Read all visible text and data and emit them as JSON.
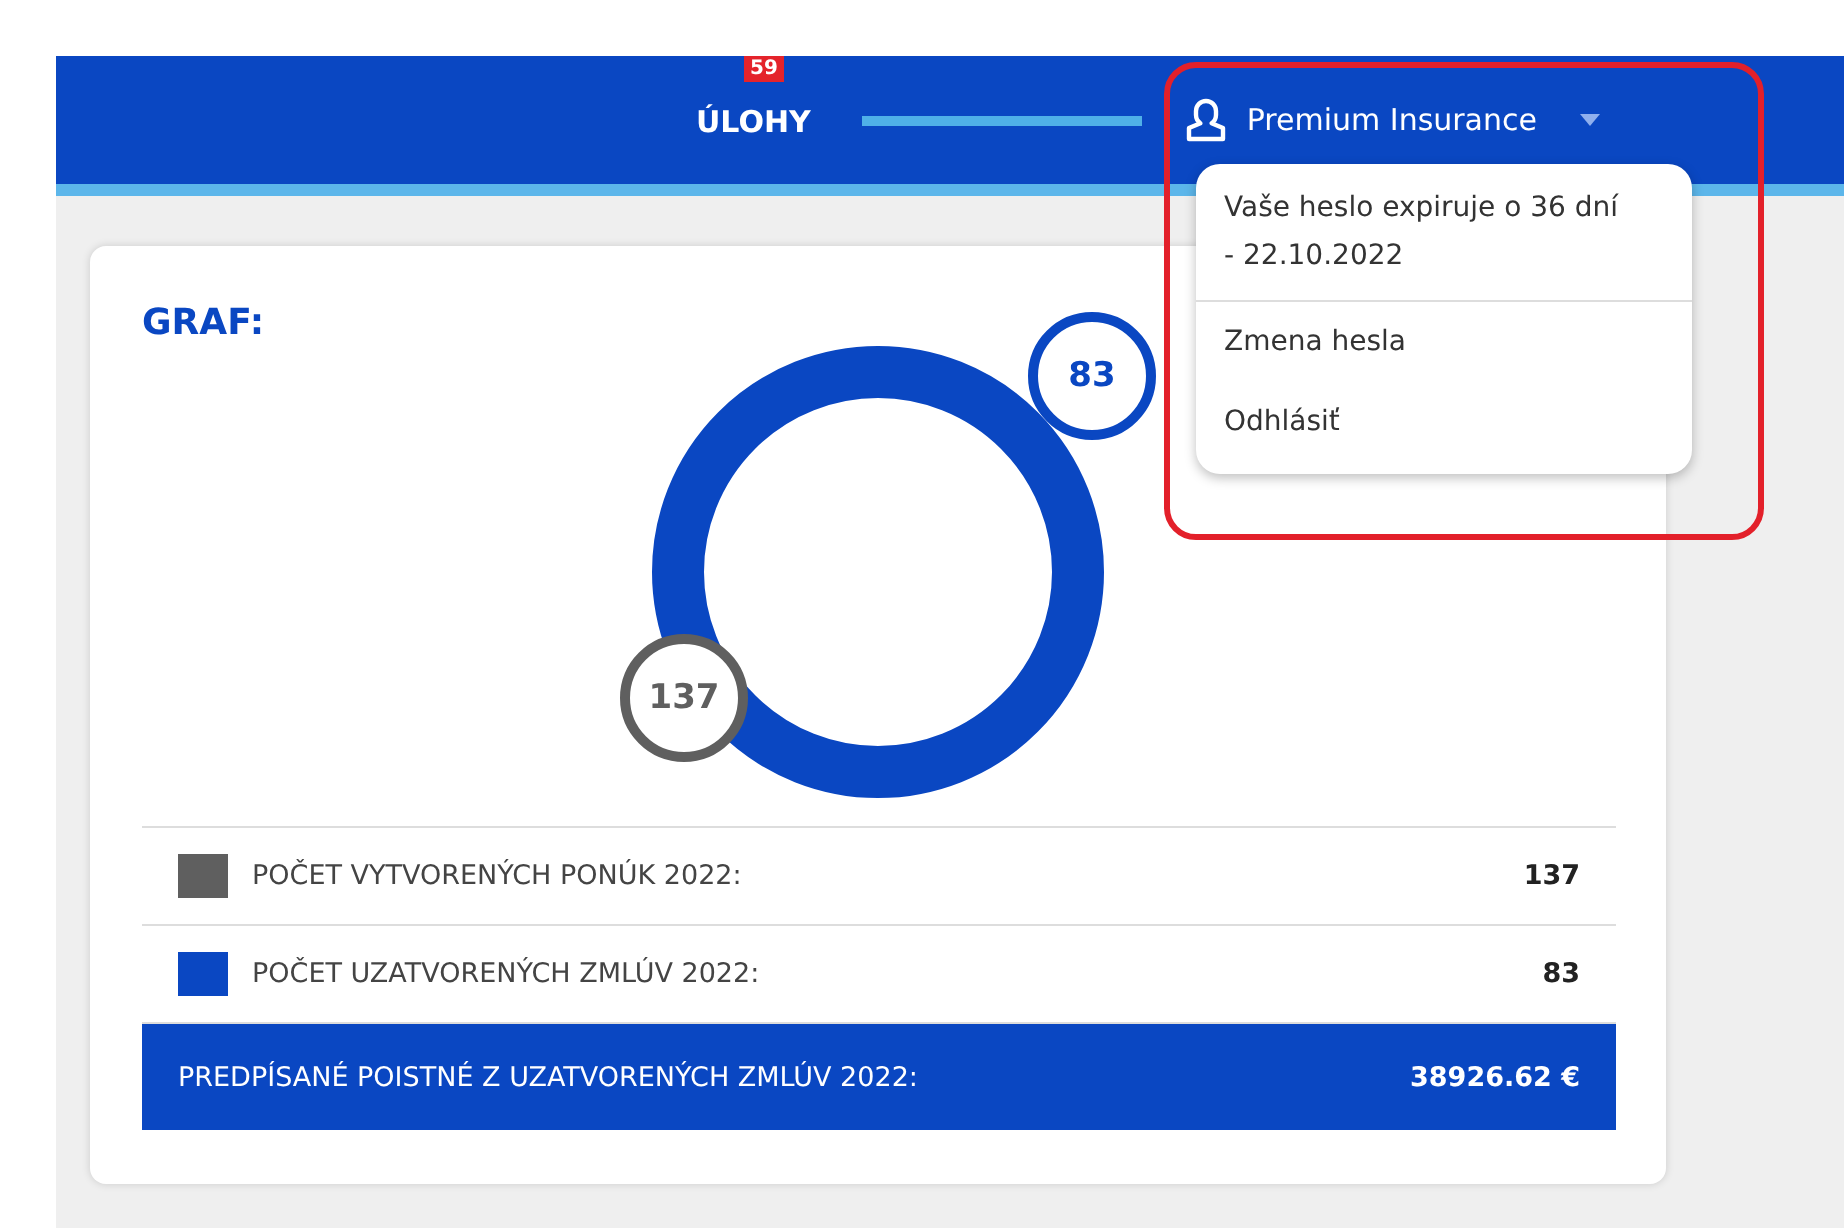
{
  "header": {
    "tasks": {
      "label": "ÚLOHY",
      "badge": "59"
    },
    "user": {
      "name": "Premium Insurance",
      "expanded": true
    }
  },
  "user_menu": {
    "items": [
      {
        "kind": "info",
        "text": "Vaše heslo expiruje o 36 dní - 22.10.2022"
      },
      {
        "kind": "link",
        "text": "Zmena hesla"
      },
      {
        "kind": "link",
        "text": "Odhlásiť"
      }
    ]
  },
  "graph": {
    "title": "GRAF:",
    "bubbles": [
      {
        "text": "83",
        "color": "#0a47c2"
      },
      {
        "text": "137",
        "color": "#5f5f5f"
      }
    ],
    "legend": [
      {
        "label": "POČET VYTVORENÝCH PONÚK 2022:",
        "value": "137",
        "color": "#5f5f5f"
      },
      {
        "label": "POČET UZATVORENÝCH ZMLÚV 2022:",
        "value": "83",
        "color": "#0a47c2"
      }
    ],
    "total": {
      "label": "PREDPÍSANÉ POISTNÉ Z UZATVORENÝCH ZMLÚV 2022:",
      "value": "38926.62 €"
    }
  }
}
